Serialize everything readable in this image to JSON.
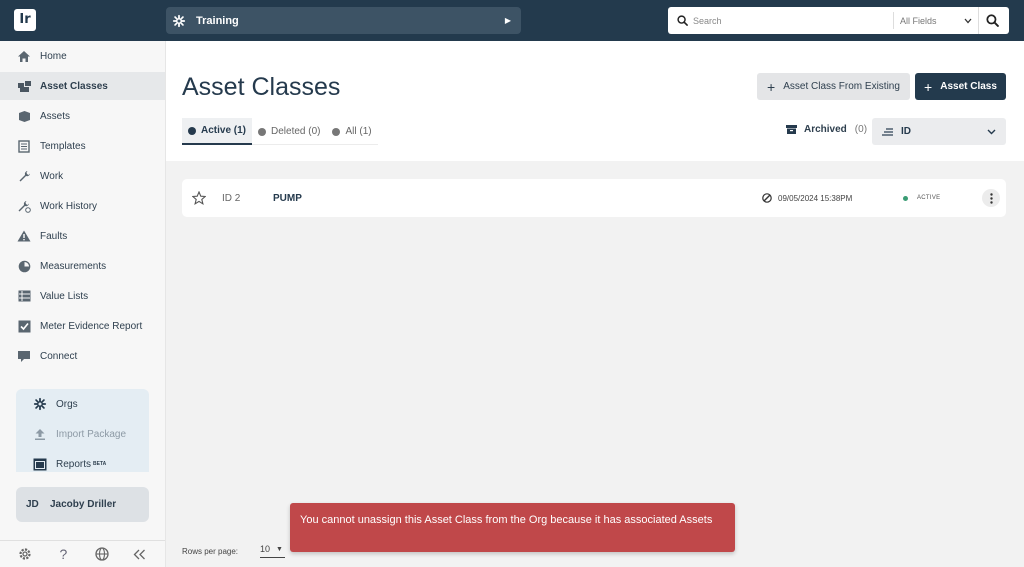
{
  "topbar": {
    "logo_text": "Ir",
    "org_name": "Training",
    "search": {
      "placeholder": "Search",
      "field_filter": "All Fields"
    }
  },
  "sidebar": {
    "items": [
      {
        "label": "Home"
      },
      {
        "label": "Asset Classes"
      },
      {
        "label": "Assets"
      },
      {
        "label": "Templates"
      },
      {
        "label": "Work"
      },
      {
        "label": "Work History"
      },
      {
        "label": "Faults"
      },
      {
        "label": "Measurements"
      },
      {
        "label": "Value Lists"
      },
      {
        "label": "Meter Evidence Report"
      },
      {
        "label": "Connect"
      }
    ],
    "panel": {
      "orgs": "Orgs",
      "import_package": "Import Package",
      "reports": "Reports",
      "reports_badge": "BETA"
    },
    "user": {
      "initials": "JD",
      "name": "Jacoby Driller"
    }
  },
  "main": {
    "title": "Asset Classes",
    "buttons": {
      "from_existing": "Asset Class From Existing",
      "add": "Asset Class"
    },
    "tabs": [
      {
        "label": "Active (1)"
      },
      {
        "label": "Deleted (0)"
      },
      {
        "label": "All (1)"
      }
    ],
    "archived": {
      "label": "Archived",
      "count": "(0)"
    },
    "sort": {
      "value": "ID"
    },
    "rows": [
      {
        "id": "ID 2",
        "name": "PUMP",
        "date": "09/05/2024 15:38PM",
        "status": "ACTIVE"
      }
    ],
    "footer": {
      "rows_per_page_label": "Rows per page:",
      "rows_per_page_value": "10"
    }
  },
  "snackbar": {
    "message": "You cannot unassign this Asset Class from the Org because it has associated Assets"
  },
  "colors": {
    "topbar": "#233a4d",
    "primary": "#233a4d",
    "error": "#c0484a",
    "active_status": "#3a9c74"
  }
}
